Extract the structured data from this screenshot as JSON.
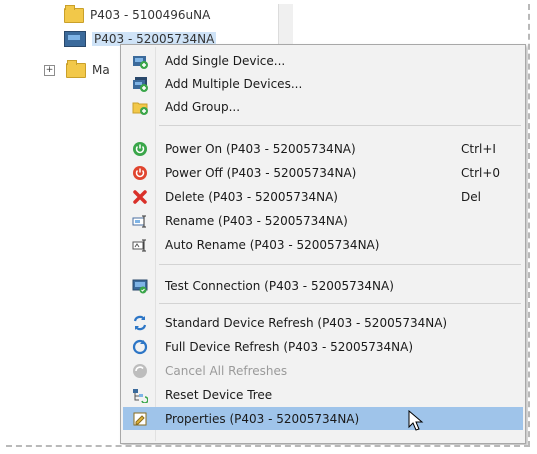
{
  "tree": {
    "items": [
      {
        "label": "P403 - 5100496uNA"
      },
      {
        "label": "P403 - 52005734NA"
      },
      {
        "label": "Ma"
      }
    ],
    "expander_glyph": "+"
  },
  "menu": {
    "items": [
      {
        "label": "Add Single Device...",
        "shortcut": "",
        "icon": "add-single-device-icon"
      },
      {
        "label": "Add Multiple Devices...",
        "shortcut": "",
        "icon": "add-multiple-devices-icon"
      },
      {
        "label": "Add Group...",
        "shortcut": "",
        "icon": "add-group-icon"
      },
      {
        "label": "Power On  (P403 - 52005734NA)",
        "shortcut": "Ctrl+I",
        "icon": "power-on-icon"
      },
      {
        "label": "Power Off  (P403 - 52005734NA)",
        "shortcut": "Ctrl+0",
        "icon": "power-off-icon"
      },
      {
        "label": "Delete  (P403 - 52005734NA)",
        "shortcut": "Del",
        "icon": "delete-icon"
      },
      {
        "label": "Rename  (P403 - 52005734NA)",
        "shortcut": "",
        "icon": "rename-icon"
      },
      {
        "label": "Auto Rename  (P403 - 52005734NA)",
        "shortcut": "",
        "icon": "auto-rename-icon"
      },
      {
        "label": "Test Connection  (P403 - 52005734NA)",
        "shortcut": "",
        "icon": "test-connection-icon"
      },
      {
        "label": "Standard Device Refresh  (P403 - 52005734NA)",
        "shortcut": "",
        "icon": "standard-refresh-icon"
      },
      {
        "label": "Full Device Refresh  (P403 - 52005734NA)",
        "shortcut": "",
        "icon": "full-refresh-icon"
      },
      {
        "label": "Cancel All Refreshes",
        "shortcut": "",
        "icon": "cancel-refresh-icon",
        "disabled": true
      },
      {
        "label": "Reset Device Tree",
        "shortcut": "",
        "icon": "reset-tree-icon"
      },
      {
        "label": "Properties  (P403 - 52005734NA)",
        "shortcut": "",
        "icon": "properties-icon",
        "highlighted": true
      }
    ]
  },
  "colors": {
    "highlight": "#9fc4ea",
    "menu_bg": "#f2f2f2",
    "power_on": "#3aa64a",
    "power_off": "#e0452f",
    "delete": "#d9302a"
  }
}
